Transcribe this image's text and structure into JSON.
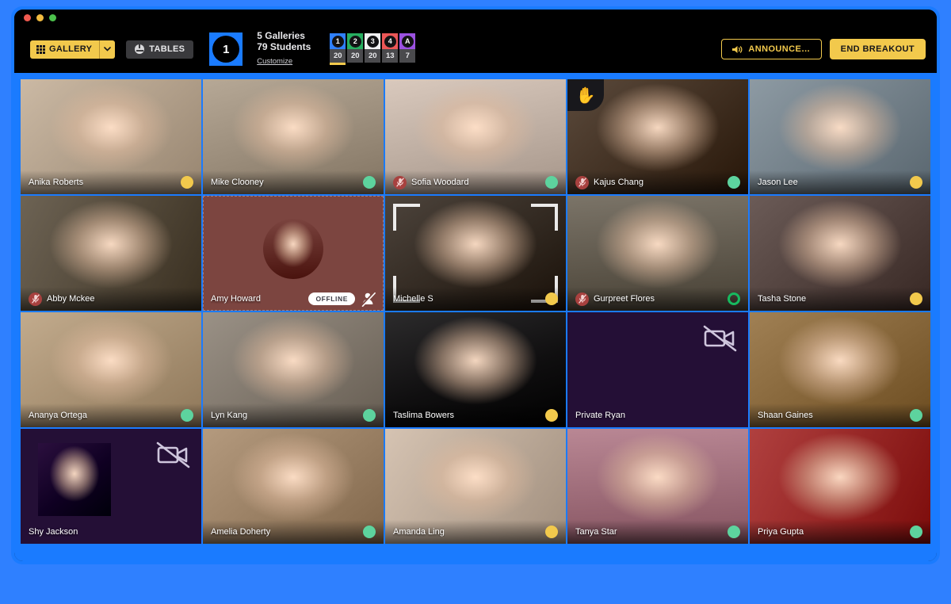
{
  "window": {
    "traffic_lights": [
      "close",
      "minimize",
      "zoom"
    ]
  },
  "toolbar": {
    "gallery_button": {
      "label": "GALLERY",
      "icon": "grid-icon",
      "caret": "⌄"
    },
    "tables_button": {
      "label": "TABLES",
      "icon": "tables-icon"
    },
    "room_number": "1",
    "galleries_line": "5 Galleries",
    "students_line": "79 Students",
    "customize_link": "Customize",
    "gallery_badges": [
      {
        "label": "1",
        "count": "20",
        "color": "#2f80ff",
        "active": true
      },
      {
        "label": "2",
        "count": "20",
        "color": "#27ae60",
        "active": false
      },
      {
        "label": "3",
        "count": "20",
        "color": "#f1f1f3",
        "active": false
      },
      {
        "label": "4",
        "count": "13",
        "color": "#eb5757",
        "active": false
      },
      {
        "label": "A",
        "count": "7",
        "color": "#9b51e0",
        "active": false
      }
    ],
    "announce_button": {
      "label": "ANNOUNCE…",
      "icon": "speaker-icon"
    },
    "end_breakout_button": {
      "label": "END BREAKOUT"
    }
  },
  "colors": {
    "accent": "#f2c94c",
    "frame": "#1a7bff",
    "muted": "#a8413f",
    "status_yellow": "#f2c94c",
    "status_green": "#5dd39e",
    "status_ring": "#17b95f",
    "offline_bg": "#7c4540",
    "camoff_bg": "#240f36"
  },
  "grid": {
    "columns": 5,
    "rows": 4,
    "participants": [
      {
        "name": "Anika Roberts",
        "muted": false,
        "status": "yellow",
        "state": "video",
        "hand": false,
        "bg": "#cbb9a4"
      },
      {
        "name": "Mike Clooney",
        "muted": false,
        "status": "green",
        "state": "video",
        "hand": false,
        "bg": "#b6a896"
      },
      {
        "name": "Sofia Woodard",
        "muted": true,
        "status": "green",
        "state": "video",
        "hand": false,
        "bg": "#d9c9bd"
      },
      {
        "name": "Kajus Chang",
        "muted": true,
        "status": "green",
        "state": "video",
        "hand": true,
        "bg": "#5b4a3c"
      },
      {
        "name": "Jason Lee",
        "muted": false,
        "status": "yellow",
        "state": "video",
        "hand": false,
        "bg": "#8d9aa3"
      },
      {
        "name": "Abby Mckee",
        "muted": true,
        "status": "none",
        "state": "video",
        "hand": false,
        "bg": "#6d6354"
      },
      {
        "name": "Amy Howard",
        "muted": false,
        "status": "none",
        "state": "offline",
        "hand": false,
        "bg": "#7c4540",
        "offline_label": "OFFLINE"
      },
      {
        "name": "Michelle S",
        "muted": false,
        "status": "yellow",
        "state": "focus",
        "hand": false,
        "bg": "#4d443c"
      },
      {
        "name": "Gurpreet Flores",
        "muted": true,
        "status": "ring",
        "state": "video",
        "hand": false,
        "bg": "#7b7468"
      },
      {
        "name": "Tasha Stone",
        "muted": false,
        "status": "yellow",
        "state": "video",
        "hand": false,
        "bg": "#6b5b57"
      },
      {
        "name": "Ananya Ortega",
        "muted": false,
        "status": "green",
        "state": "video",
        "hand": false,
        "bg": "#c2ab8d"
      },
      {
        "name": "Lyn Kang",
        "muted": false,
        "status": "green",
        "state": "video",
        "hand": false,
        "bg": "#9a9186"
      },
      {
        "name": "Taslima Bowers",
        "muted": false,
        "status": "yellow",
        "state": "video",
        "hand": false,
        "bg": "#2c2b2c"
      },
      {
        "name": "Private Ryan",
        "muted": false,
        "status": "none",
        "state": "camoff",
        "hand": false,
        "bg": "#240f36"
      },
      {
        "name": "Shaan Gaines",
        "muted": false,
        "status": "green",
        "state": "video",
        "hand": false,
        "bg": "#a08054"
      },
      {
        "name": "Shy Jackson",
        "muted": false,
        "status": "none",
        "state": "camoff-avatar",
        "hand": false,
        "bg": "#2b0f3e"
      },
      {
        "name": "Amelia Doherty",
        "muted": false,
        "status": "green",
        "state": "video",
        "hand": false,
        "bg": "#b49a7e"
      },
      {
        "name": "Amanda Ling",
        "muted": false,
        "status": "yellow",
        "state": "video",
        "hand": false,
        "bg": "#d5c3b2"
      },
      {
        "name": "Tanya Star",
        "muted": false,
        "status": "green",
        "state": "video",
        "hand": false,
        "bg": "#b98794"
      },
      {
        "name": "Priya Gupta",
        "muted": false,
        "status": "green",
        "state": "video",
        "hand": false,
        "bg": "#b0403f"
      }
    ]
  }
}
